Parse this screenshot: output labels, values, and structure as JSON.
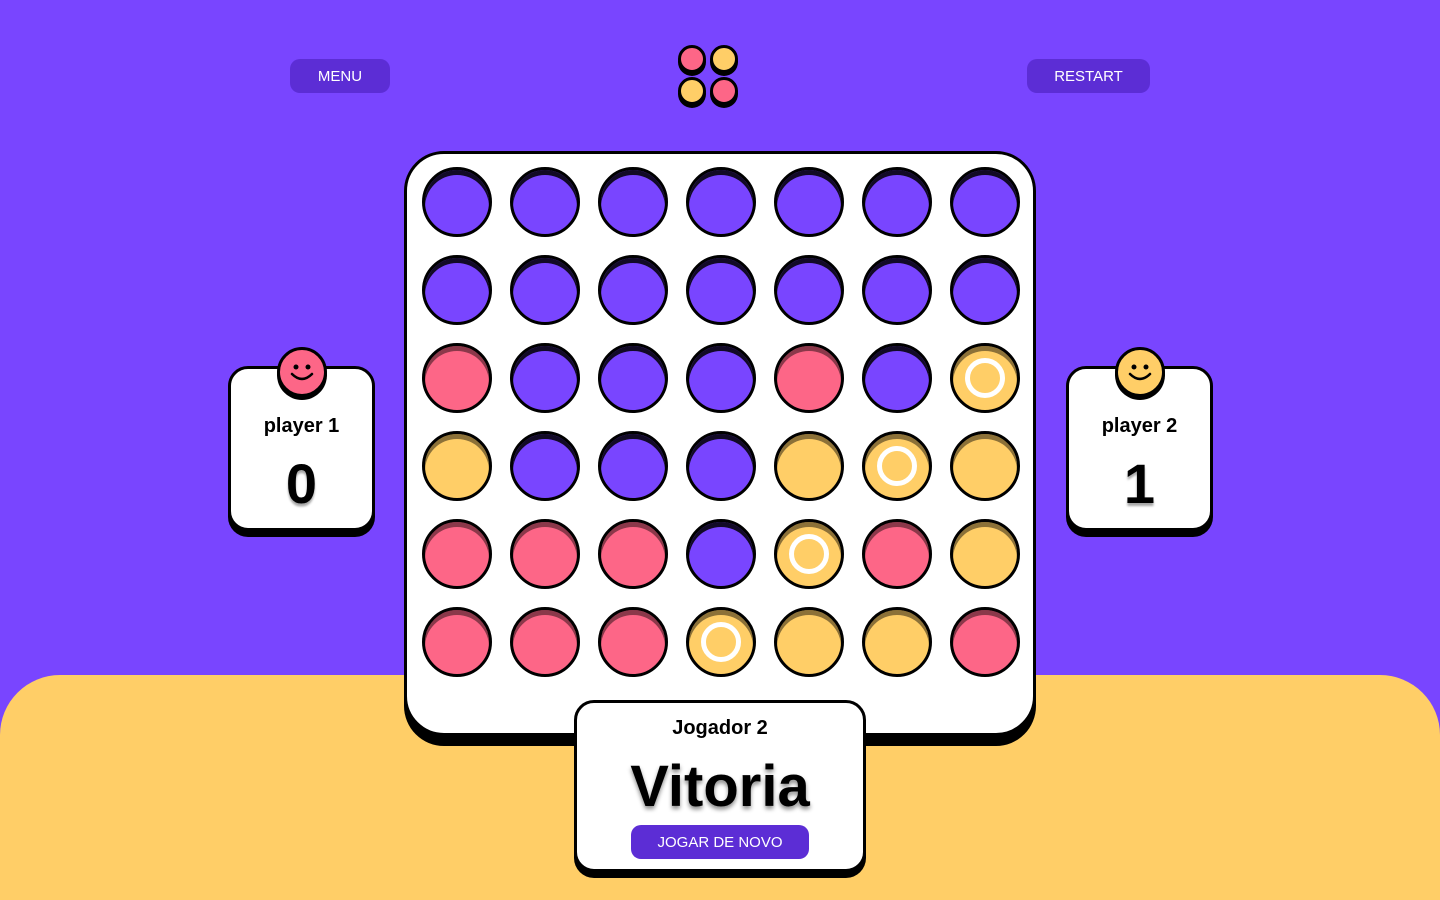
{
  "header": {
    "menu_label": "MENU",
    "restart_label": "RESTART"
  },
  "colors": {
    "background": "#7945ff",
    "accent_dark": "#5c2dd5",
    "red": "#fd6687",
    "yellow": "#ffce67",
    "board": "#ffffff"
  },
  "players": [
    {
      "name": "player 1",
      "score": "0",
      "color": "red",
      "icon": "smiley-face-icon"
    },
    {
      "name": "player 2",
      "score": "1",
      "color": "yellow",
      "icon": "smiley-face-icon"
    }
  ],
  "board": {
    "rows": 6,
    "columns": 7,
    "cells": [
      [
        "empty",
        "empty",
        "empty",
        "empty",
        "empty",
        "empty",
        "empty"
      ],
      [
        "empty",
        "empty",
        "empty",
        "empty",
        "empty",
        "empty",
        "empty"
      ],
      [
        "red",
        "empty",
        "empty",
        "empty",
        "red",
        "empty",
        "yellow"
      ],
      [
        "yellow",
        "empty",
        "empty",
        "empty",
        "yellow",
        "yellow",
        "yellow"
      ],
      [
        "red",
        "red",
        "red",
        "empty",
        "yellow",
        "red",
        "yellow"
      ],
      [
        "red",
        "red",
        "red",
        "yellow",
        "yellow",
        "yellow",
        "red"
      ]
    ],
    "winning_cells": [
      [
        2,
        6
      ],
      [
        3,
        5
      ],
      [
        4,
        4
      ],
      [
        5,
        3
      ]
    ]
  },
  "result": {
    "player_label": "Jogador 2",
    "result_text": "Vitoria",
    "play_again_label": "JOGAR DE NOVO"
  }
}
